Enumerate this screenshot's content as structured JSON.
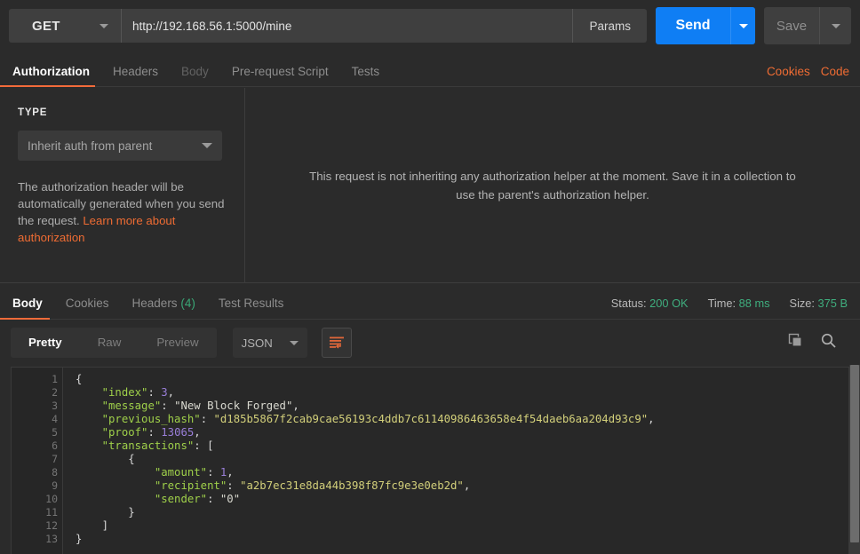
{
  "request": {
    "method": "GET",
    "url": "http://192.168.56.1:5000/mine",
    "params_label": "Params",
    "send_label": "Send",
    "save_label": "Save"
  },
  "request_tabs": [
    {
      "label": "Authorization",
      "state": "active"
    },
    {
      "label": "Headers",
      "state": "normal"
    },
    {
      "label": "Body",
      "state": "dim"
    },
    {
      "label": "Pre-request Script",
      "state": "normal"
    },
    {
      "label": "Tests",
      "state": "normal"
    }
  ],
  "request_tabs_right": [
    {
      "label": "Cookies"
    },
    {
      "label": "Code"
    }
  ],
  "auth": {
    "type_label": "TYPE",
    "type_value": "Inherit auth from parent",
    "description_pre": "The authorization header will be automatically generated when you send the request. ",
    "description_link": "Learn more about authorization",
    "inherit_note": "This request is not inheriting any authorization helper at the moment. Save it in a collection to use the parent's authorization helper."
  },
  "response_tabs": [
    {
      "label": "Body",
      "state": "active",
      "count": ""
    },
    {
      "label": "Cookies",
      "state": "normal",
      "count": ""
    },
    {
      "label": "Headers",
      "state": "normal",
      "count": "(4)"
    },
    {
      "label": "Test Results",
      "state": "normal",
      "count": ""
    }
  ],
  "response_meta": {
    "status_key": "Status:",
    "status_value": "200 OK",
    "time_key": "Time:",
    "time_value": "88 ms",
    "size_key": "Size:",
    "size_value": "375 B"
  },
  "viewer_toolbar": {
    "segments": [
      {
        "label": "Pretty",
        "state": "active"
      },
      {
        "label": "Raw",
        "state": "normal"
      },
      {
        "label": "Preview",
        "state": "normal"
      }
    ],
    "format": "JSON",
    "wrap_icon": "word-wrap-icon",
    "copy_icon": "copy-icon",
    "search_icon": "search-icon"
  },
  "response_body": {
    "line_numbers": [
      "1",
      "2",
      "3",
      "4",
      "5",
      "6",
      "7",
      "8",
      "9",
      "10",
      "11",
      "12",
      "13"
    ],
    "fold_lines": [
      1,
      6,
      7
    ],
    "values": {
      "index": 3,
      "message": "New Block Forged",
      "previous_hash": "d185b5867f2cab9cae56193c4ddb7c61140986463658e4f54daeb6aa204d93c9",
      "proof": 13065,
      "transactions": [
        {
          "amount": 1,
          "recipient": "a2b7ec31e8da44b398f87fc9e3e0eb2d",
          "sender": "0"
        }
      ]
    },
    "lines": [
      "{",
      "    \"index\": 3,",
      "    \"message\": \"New Block Forged\",",
      "    \"previous_hash\": \"d185b5867f2cab9cae56193c4ddb7c61140986463658e4f54daeb6aa204d93c9\",",
      "    \"proof\": 13065,",
      "    \"transactions\": [",
      "        {",
      "            \"amount\": 1,",
      "            \"recipient\": \"a2b7ec31e8da44b398f87fc9e3e0eb2d\",",
      "            \"sender\": \"0\"",
      "        }",
      "    ]",
      "}"
    ]
  },
  "colors": {
    "accent_orange": "#f26b3a",
    "send_blue": "#0f7ef4",
    "status_green": "#3fae7e",
    "key_green": "#9fd04a",
    "number_purple": "#9a7fd9",
    "hash_yellow": "#d2cf7a",
    "background": "#2b2b2b"
  }
}
